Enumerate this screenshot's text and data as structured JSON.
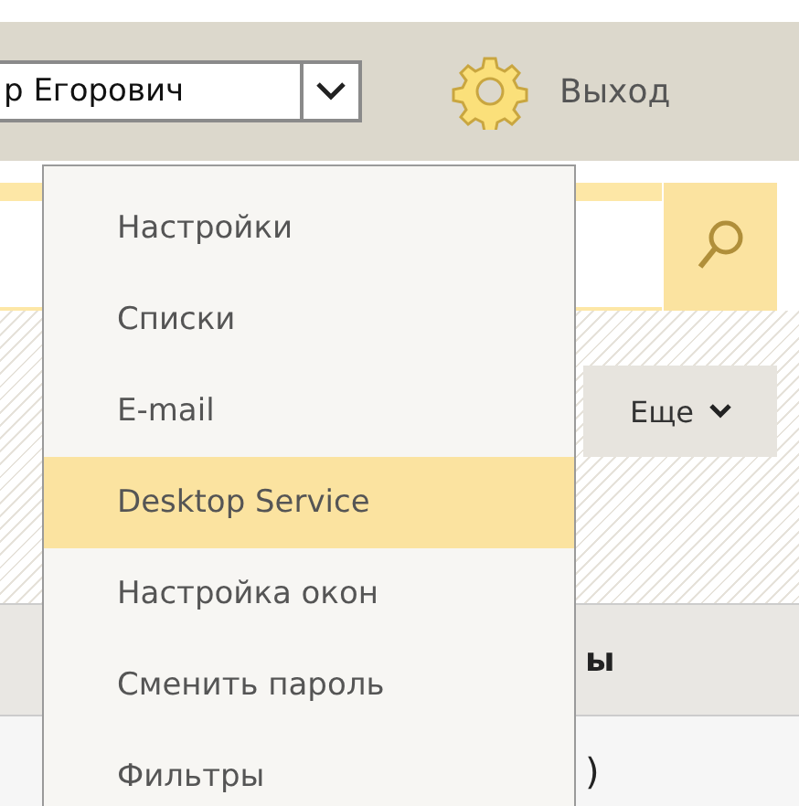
{
  "header": {
    "user_select": {
      "value": "р Егорович"
    },
    "logout": "Выход"
  },
  "toolbar": {
    "more_button": "Еще"
  },
  "table": {
    "column_header": "ы",
    "cell": ")"
  },
  "settings_menu": {
    "items": [
      {
        "label": "Настройки",
        "selected": false
      },
      {
        "label": "Списки",
        "selected": false
      },
      {
        "label": "E-mail",
        "selected": false
      },
      {
        "label": "Desktop Service",
        "selected": true
      },
      {
        "label": "Настройка окон",
        "selected": false
      },
      {
        "label": "Сменить пароль",
        "selected": false
      },
      {
        "label": "Фильтры",
        "selected": false
      }
    ]
  }
}
